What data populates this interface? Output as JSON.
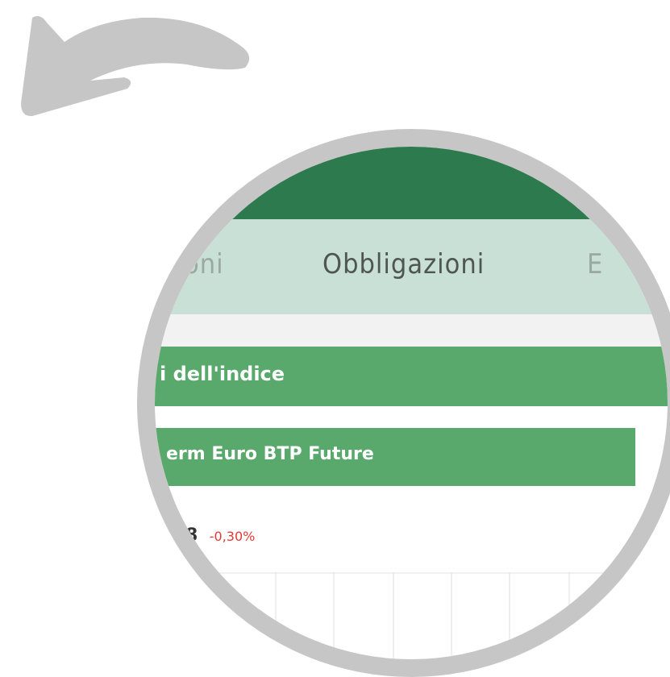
{
  "tabs": {
    "prev_label": "oni",
    "active_label": "Obbligazioni",
    "next_label": "E"
  },
  "section": {
    "title": "i dell'indice"
  },
  "index": {
    "name": "erm Euro BTP Future"
  },
  "quote": {
    "value": "8",
    "change": "-0,30%"
  },
  "colors": {
    "header": "#2c7a4d",
    "tabs_bg": "#c8e0d6",
    "accent_green": "#58a96b",
    "negative": "#e53935",
    "ring": "#c6c6c6",
    "arrow": "#c6c6c6"
  },
  "icons": {
    "back_arrow": "curved-back-arrow-icon"
  }
}
